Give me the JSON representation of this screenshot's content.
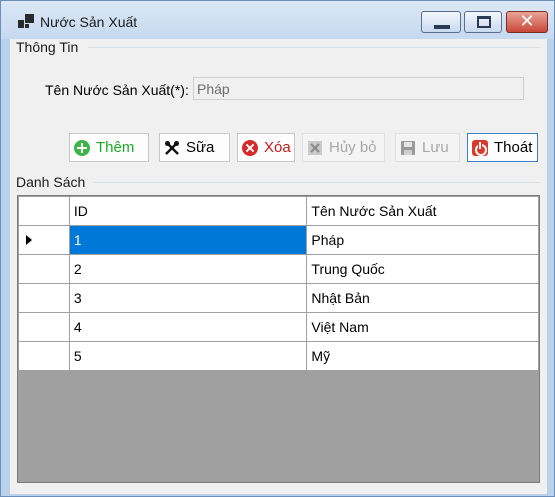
{
  "window": {
    "title": "Nước Sản Xuất",
    "controls": [
      "minimize-icon",
      "maximize-icon",
      "close-icon"
    ]
  },
  "info_group": {
    "legend": "Thông Tin",
    "field_label": "Tên Nước Sản Xuất(*):",
    "field_value": "Pháp"
  },
  "toolbar": {
    "add_label": "Thêm",
    "edit_label": "Sữa",
    "delete_label": "Xóa",
    "cancel_label": "Hủy bỏ",
    "save_label": "Lưu",
    "exit_label": "Thoát",
    "icons": [
      "plus-circle-icon",
      "tools-icon",
      "delete-circle-icon",
      "cancel-icon",
      "save-icon",
      "power-icon"
    ]
  },
  "list_group": {
    "legend": "Danh Sách",
    "columns": [
      "ID",
      "Tên Nước Sản Xuất"
    ],
    "rows": [
      {
        "id": "1",
        "name": "Pháp"
      },
      {
        "id": "2",
        "name": "Trung Quốc"
      },
      {
        "id": "3",
        "name": "Nhật Bản"
      },
      {
        "id": "4",
        "name": "Việt Nam"
      },
      {
        "id": "5",
        "name": "Mỹ"
      }
    ],
    "selected_row": 0
  },
  "colors": {
    "selection": "#0078d7",
    "add_text": "#1fa82a",
    "delete_text": "#c21a1a",
    "disabled_text": "#a8a8a8",
    "grid_empty": "#a0a0a0"
  }
}
